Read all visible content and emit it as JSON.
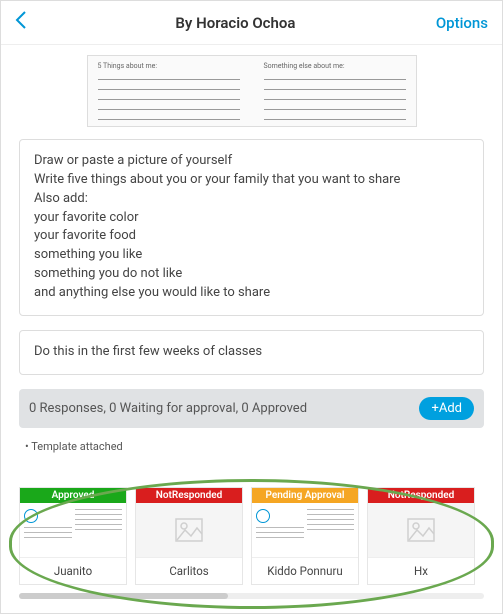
{
  "header": {
    "title": "By Horacio Ochoa",
    "options": "Options"
  },
  "worksheet": {
    "left_heading": "5 Things about me:",
    "right_heading": "Something else about me:"
  },
  "instructions": [
    "Draw or paste a picture of yourself",
    "Write five things about you or your family that you want to share",
    "Also add:",
    "your favorite color",
    "your favorite food",
    "something you like",
    "something you do not like",
    "and anything else you would like to share"
  ],
  "timing_note": "Do this in the first few weeks of classes",
  "status": {
    "text": "0 Responses, 0 Waiting for approval, 0 Approved",
    "add_label": "+Add"
  },
  "template_note": "Template attached",
  "responses": [
    {
      "status": "Approved",
      "status_class": "approved",
      "name": "Juanito",
      "thumb": "doc"
    },
    {
      "status": "NotResponded",
      "status_class": "notresp",
      "name": "Carlitos",
      "thumb": "placeholder"
    },
    {
      "status": "Pending Approval",
      "status_class": "pending",
      "name": "Kiddo Ponnuru",
      "thumb": "doc"
    },
    {
      "status": "NotResponded",
      "status_class": "notresp",
      "name": "Hx",
      "thumb": "placeholder"
    }
  ]
}
